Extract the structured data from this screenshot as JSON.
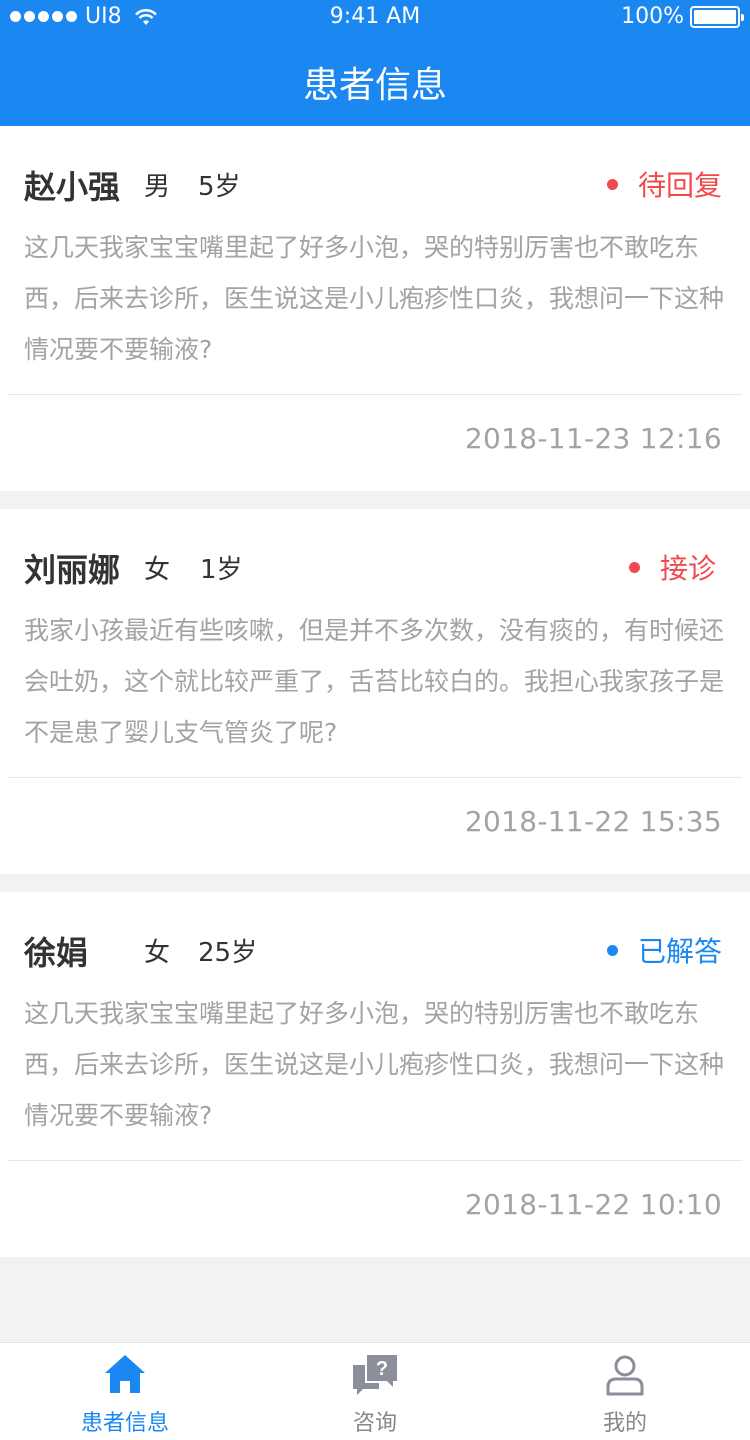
{
  "status_bar": {
    "carrier": "UI8",
    "time": "9:41 AM",
    "battery": "100%"
  },
  "header": {
    "title": "患者信息"
  },
  "patients": [
    {
      "name": "赵小强",
      "gender": "男",
      "age": "5岁",
      "status": "待回复",
      "status_color": "#f2494c",
      "description": "这几天我家宝宝嘴里起了好多小泡，哭的特别厉害也不敢吃东西，后来去诊所，医生说这是小儿疱疹性口炎，我想问一下这种情况要不要输液?",
      "time": "2018-11-23  12:16"
    },
    {
      "name": "刘丽娜",
      "gender": "女",
      "age": "1岁",
      "status": "接诊",
      "status_color": "#f2494c",
      "description": "我家小孩最近有些咳嗽，但是并不多次数，没有痰的，有时候还会吐奶，这个就比较严重了，舌苔比较白的。我担心我家孩子是不是患了婴儿支气管炎了呢?",
      "time": "2018-11-22  15:35"
    },
    {
      "name": "徐娟",
      "gender": "女",
      "age": "25岁",
      "status": "已解答",
      "status_color": "#1b87f0",
      "description": "这几天我家宝宝嘴里起了好多小泡，哭的特别厉害也不敢吃东西，后来去诊所，医生说这是小儿疱疹性口炎，我想问一下这种情况要不要输液?",
      "time": "2018-11-22  10:10"
    }
  ],
  "tabbar": {
    "items": [
      {
        "label": "患者信息",
        "icon": "home-icon",
        "active": true
      },
      {
        "label": "咨询",
        "icon": "consult-icon",
        "active": false
      },
      {
        "label": "我的",
        "icon": "user-icon",
        "active": false
      }
    ],
    "active_color": "#1b87f0",
    "inactive_color": "#888888"
  }
}
